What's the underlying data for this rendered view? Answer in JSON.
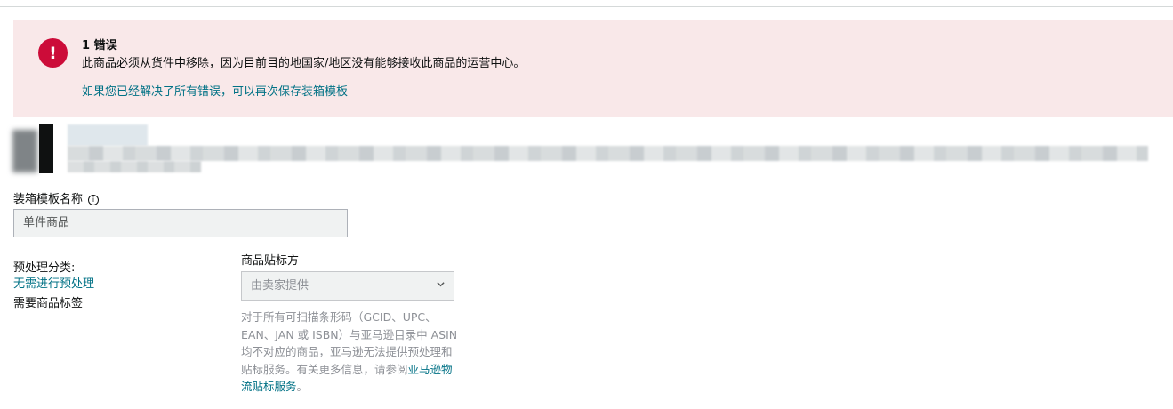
{
  "alert": {
    "icon": "exclamation-icon",
    "icon_glyph": "!",
    "title": "1 错误",
    "message": "此商品必须从货件中移除，因为目前目的地国家/地区没有能够接收此商品的运营中心。",
    "action_link": "如果您已经解决了所有错误，可以再次保存装箱模板",
    "bg_color": "#f9e8e9",
    "icon_color": "#cc0c39"
  },
  "packing_template": {
    "label": "装箱模板名称",
    "info_icon": "info-icon",
    "value": "单件商品"
  },
  "prep": {
    "category_label": "预处理分类:",
    "category_value": "无需进行预处理",
    "label_required": "需要商品标签"
  },
  "labeling": {
    "label": "商品贴标方",
    "selected": "由卖家提供",
    "chevron_icon": "chevron-down-icon",
    "help_text": "对于所有可扫描条形码（GCID、UPC、EAN、JAN 或 ISBN）与亚马逊目录中 ASIN 均不对应的商品，亚马逊无法提供预处理和贴标服务。有关更多信息，请参阅",
    "help_link": "亚马逊物流贴标服务",
    "help_suffix": "。"
  },
  "colors": {
    "link": "#007185"
  }
}
